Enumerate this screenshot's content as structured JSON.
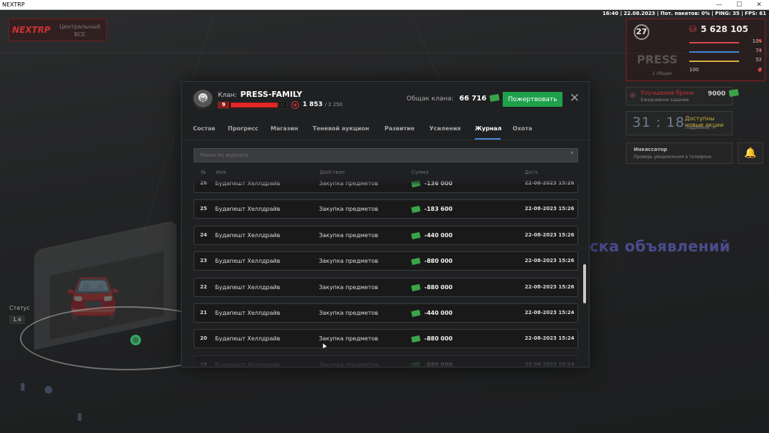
{
  "window": {
    "title": "NEXTRP",
    "min": "—",
    "max": "☐",
    "close": "✕"
  },
  "hud": {
    "status_line": "16:40 | 22.08.2023 | Пот. пакетов: 0% | PING: 35 | FPS: 61",
    "logo": "NEXTRP",
    "server_name": "Центральный",
    "server_sub": "BCE",
    "level": "27",
    "money": "5 628 105",
    "stats": [
      {
        "value": "104",
        "color": "#d94a4a"
      },
      {
        "value": "74",
        "color": "#3f86d9"
      },
      {
        "value": "52",
        "color": "#d9b23f"
      },
      {
        "value": "0",
        "color": "#7a7a7a"
      }
    ],
    "stat_extra": "100",
    "emblem_text": "PRESS",
    "emblem_sub": "2 Общее",
    "upgrade_title": "Улучшение брони",
    "upgrade_sub": "Ежедневное задание",
    "upgrade_value": "9000",
    "timer": "31 : 18",
    "promo_title": "Доступны новые акции",
    "promo_sub": "Подробнее →",
    "notify_title": "Инкассатор",
    "notify_sub": "Проверь уведомления в телефоне",
    "status_label": "Статус",
    "status_value": "1.4",
    "bg_text": "ска объявлений"
  },
  "clan": {
    "label": "Клан:",
    "name": "PRESS-FAMILY",
    "level": "9",
    "xp_fraction": 0.87,
    "members": "1 853",
    "members_max": "/ 2 250",
    "treasury_label": "Общак клана:",
    "treasury_value": "66 716",
    "donate_label": "Пожертвовать",
    "close": "✕"
  },
  "tabs": [
    {
      "label": "Состав",
      "active": false
    },
    {
      "label": "Прогресс",
      "active": false
    },
    {
      "label": "Магазин",
      "active": false
    },
    {
      "label": "Теневой аукцион",
      "active": false
    },
    {
      "label": "Развитие",
      "active": false
    },
    {
      "label": "Усиления",
      "active": false
    },
    {
      "label": "Журнал",
      "active": true
    },
    {
      "label": "Охота",
      "active": false
    }
  ],
  "search": {
    "placeholder": "Поиск по журналу",
    "value": ""
  },
  "columns": {
    "num": "№",
    "name": "Имя",
    "action": "Действие",
    "amount": "Сумма",
    "date": "Дата"
  },
  "log_rows": [
    {
      "num": "26",
      "name": "Будапешт Хеллдрайв",
      "action": "Закупка предметов",
      "amount": "-136 000",
      "date": "22-08-2023 15:26"
    },
    {
      "num": "25",
      "name": "Будапешт Хеллдрайв",
      "action": "Закупка предметов",
      "amount": "-183 600",
      "date": "22-08-2023 15:26"
    },
    {
      "num": "24",
      "name": "Будапешт Хеллдрайв",
      "action": "Закупка предметов",
      "amount": "-440 000",
      "date": "22-08-2023 15:26"
    },
    {
      "num": "23",
      "name": "Будапешт Хеллдрайв",
      "action": "Закупка предметов",
      "amount": "-880 000",
      "date": "22-08-2023 15:26"
    },
    {
      "num": "22",
      "name": "Будапешт Хеллдрайв",
      "action": "Закупка предметов",
      "amount": "-880 000",
      "date": "22-08-2023 15:26"
    },
    {
      "num": "21",
      "name": "Будапешт Хеллдрайв",
      "action": "Закупка предметов",
      "amount": "-440 000",
      "date": "22-08-2023 15:24"
    },
    {
      "num": "20",
      "name": "Будапешт Хеллдрайв",
      "action": "Закупка предметов",
      "amount": "-880 000",
      "date": "22-08-2023 15:24"
    },
    {
      "num": "19",
      "name": "Будапешт Хеллдрайв",
      "action": "Закупка предметов",
      "amount": "-880 000",
      "date": "22-08-2023 15:24"
    }
  ]
}
